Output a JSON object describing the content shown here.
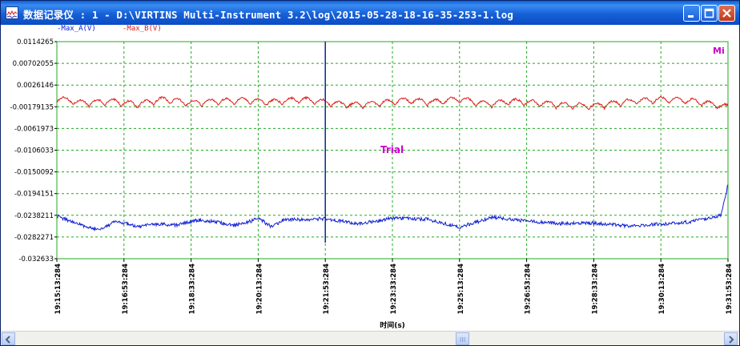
{
  "window": {
    "title": "数据记录仪 : 1 - D:\\VIRTINS Multi-Instrument 3.2\\log\\2015-05-28-18-16-35-253-1.log",
    "icon": "chart-log-icon",
    "controls": [
      "minimize-icon",
      "maximize-icon",
      "close-icon"
    ]
  },
  "legend": {
    "series_a": "-Max_A(V)",
    "series_b": "-Max_B(V)"
  },
  "overlay": {
    "corner_mark": "Mi",
    "watermark": "Trial"
  },
  "colors": {
    "series_a": "#1020d0",
    "series_b": "#e01818",
    "grid": "#22aa22",
    "cursor": "#0a2a8a",
    "watermark": "#cc00cc"
  },
  "chart_data": {
    "type": "line",
    "xlabel": "时间(s)",
    "ylabel": "",
    "y_ticks": [
      "0.0114265",
      "0.00702055",
      "0.0026146",
      "-0.00179135",
      "-0.0061973",
      "-0.0106033",
      "-0.0150092",
      "-0.0194151",
      "-0.0238211",
      "-0.0282271",
      "-0.032633"
    ],
    "ylim": [
      -0.032633,
      0.0114265
    ],
    "x_ticks": [
      "19:15:13:284",
      "19:16:53:284",
      "19:18:33:284",
      "19:20:13:284",
      "19:21:53:284",
      "19:23:33:284",
      "19:25:13:284",
      "19:26:53:284",
      "19:28:33:284",
      "19:30:13:284",
      "19:31:53:284"
    ],
    "x_range_seconds": 1000,
    "cursor_time": "19:21:53:284",
    "grid": true,
    "series": [
      {
        "name": "-Max_A(V)",
        "x_seconds": [
          0,
          30,
          60,
          90,
          120,
          150,
          180,
          210,
          240,
          260,
          280,
          300,
          320,
          340,
          360,
          400,
          450,
          500,
          550,
          600,
          650,
          700,
          750,
          800,
          850,
          900,
          940,
          970,
          990,
          1000
        ],
        "values": [
          -0.024,
          -0.0255,
          -0.0268,
          -0.025,
          -0.0262,
          -0.0256,
          -0.0258,
          -0.0248,
          -0.0252,
          -0.0258,
          -0.0255,
          -0.0244,
          -0.0262,
          -0.0246,
          -0.0247,
          -0.0245,
          -0.0256,
          -0.0244,
          -0.0246,
          -0.0262,
          -0.0242,
          -0.025,
          -0.0255,
          -0.0254,
          -0.026,
          -0.0256,
          -0.0252,
          -0.0244,
          -0.0238,
          -0.0175
        ]
      },
      {
        "name": "-Max_B(V)",
        "x_seconds": [
          0,
          40,
          80,
          120,
          160,
          200,
          240,
          280,
          320,
          360,
          400,
          440,
          480,
          520,
          560,
          600,
          640,
          680,
          720,
          760,
          800,
          840,
          880,
          920,
          960,
          1000
        ],
        "values": [
          -0.0002,
          -0.0012,
          -0.0008,
          -0.0014,
          -0.0004,
          -0.0012,
          -0.0008,
          -0.0006,
          -0.001,
          -0.0004,
          -0.001,
          -0.0016,
          -0.0012,
          -0.0006,
          -0.001,
          -0.0004,
          -0.0014,
          -0.0008,
          -0.0012,
          -0.0016,
          -0.0018,
          -0.001,
          -0.0006,
          -0.0004,
          -0.001,
          -0.002
        ]
      }
    ]
  }
}
